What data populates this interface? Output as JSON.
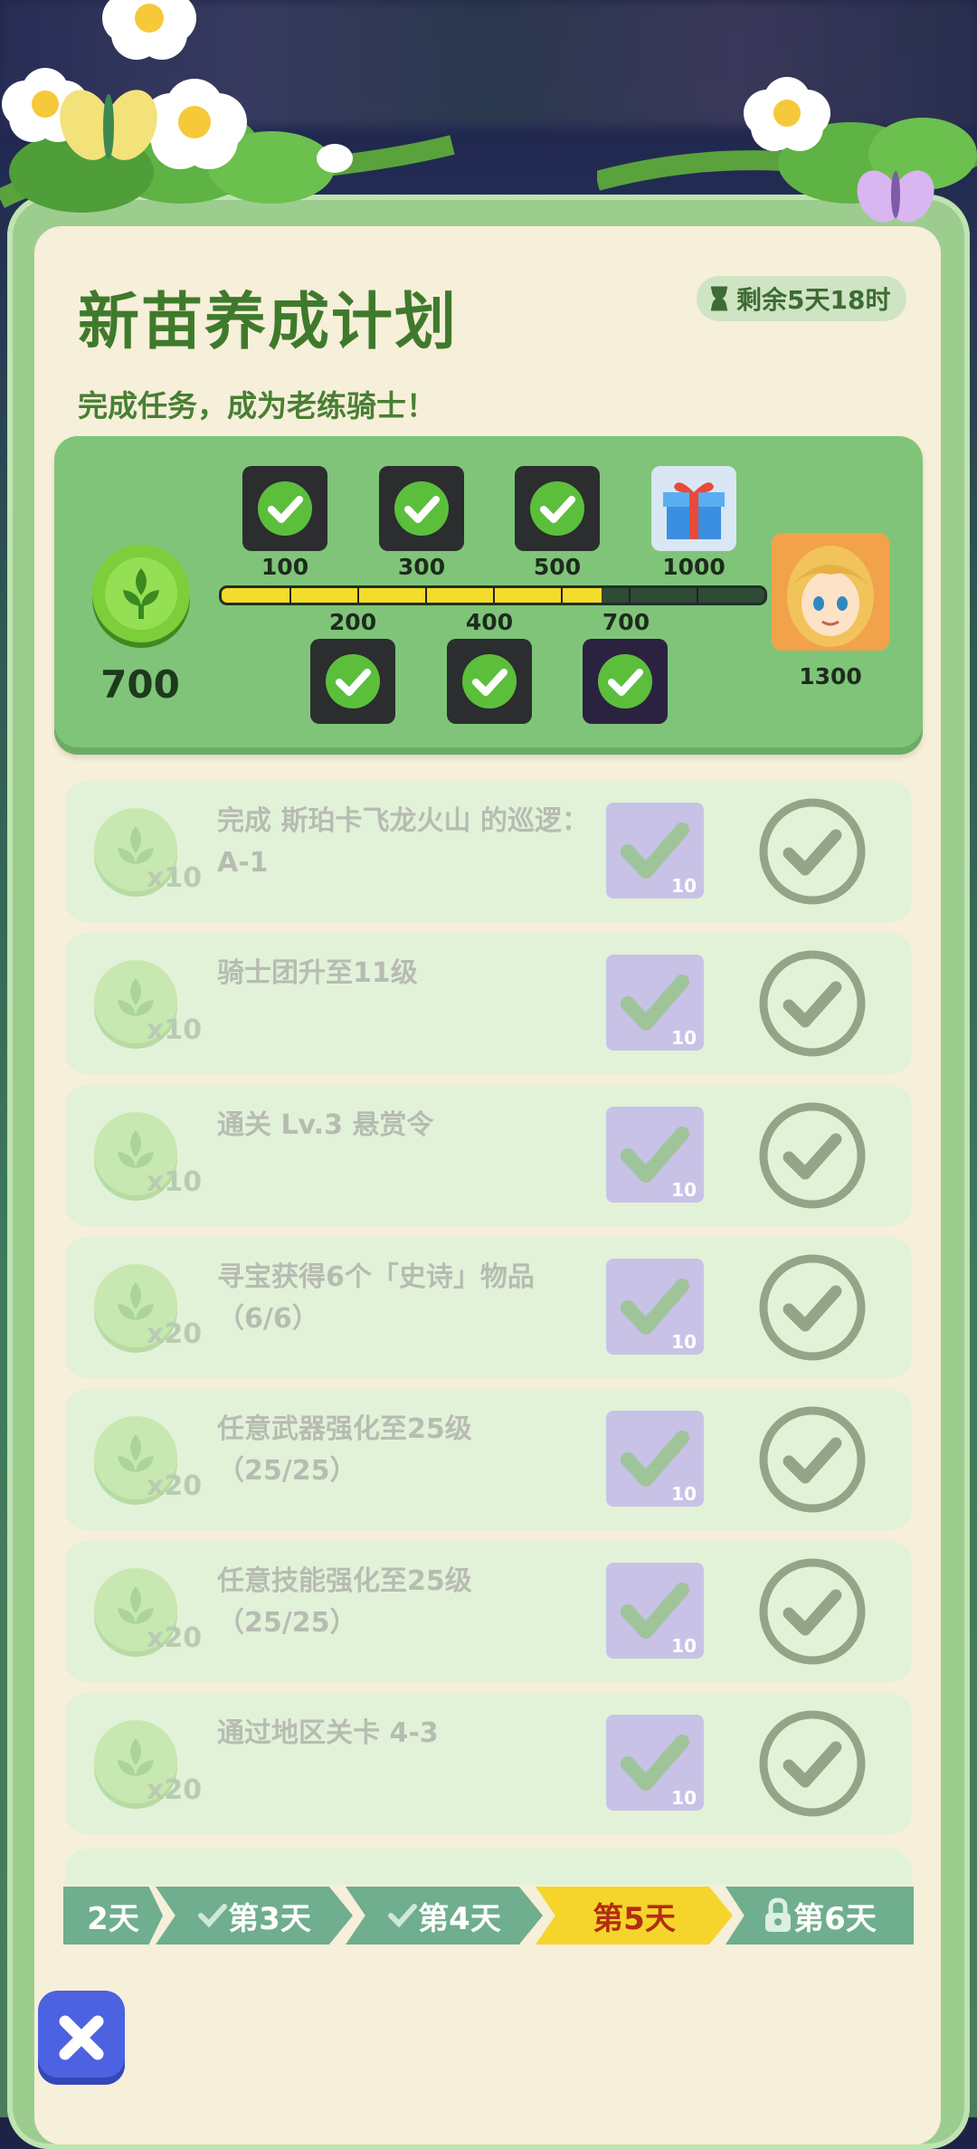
{
  "header": {
    "title": "新苗养成计划",
    "timer": "剩余5天18时",
    "subtitle": "完成任务，成为老练骑士！"
  },
  "progress": {
    "points": "700",
    "fill_fraction": 0.7,
    "top_milestones": [
      "100",
      "300",
      "500",
      "1000"
    ],
    "bottom_milestones": [
      "200",
      "400",
      "700"
    ],
    "final_reward_value": "1300"
  },
  "tasks": [
    {
      "text": "完成 斯珀卡飞龙火山 的巡逻：A-1",
      "qty": "x10",
      "reward_num": "10"
    },
    {
      "text": "骑士团升至11级",
      "qty": "x10",
      "reward_num": "10"
    },
    {
      "text": "通关 Lv.3 悬赏令",
      "qty": "x10",
      "reward_num": "10"
    },
    {
      "text": "寻宝获得6个「史诗」物品（6/6）",
      "qty": "x20",
      "reward_num": "10"
    },
    {
      "text": "任意武器强化至25级（25/25）",
      "qty": "x20",
      "reward_num": "10"
    },
    {
      "text": "任意技能强化至25级（25/25）",
      "qty": "x20",
      "reward_num": "10"
    },
    {
      "text": "通过地区关卡 4-3",
      "qty": "x20",
      "reward_num": "10"
    }
  ],
  "day_tabs": [
    {
      "label": "2天",
      "state": "done"
    },
    {
      "label": "第3天",
      "state": "done"
    },
    {
      "label": "第4天",
      "state": "done"
    },
    {
      "label": "第5天",
      "state": "active"
    },
    {
      "label": "第6天",
      "state": "locked"
    }
  ],
  "colors": {
    "title_green": "#3f7a2c",
    "active_tab": "#f5d52b",
    "active_tab_text": "#b42c12",
    "close_button": "#4d62e0"
  },
  "icons": {
    "timer": "hourglass-icon",
    "coin": "leaf-coin-icon",
    "check": "check-icon",
    "gift": "gift-icon",
    "lock": "lock-icon",
    "close": "close-icon"
  }
}
